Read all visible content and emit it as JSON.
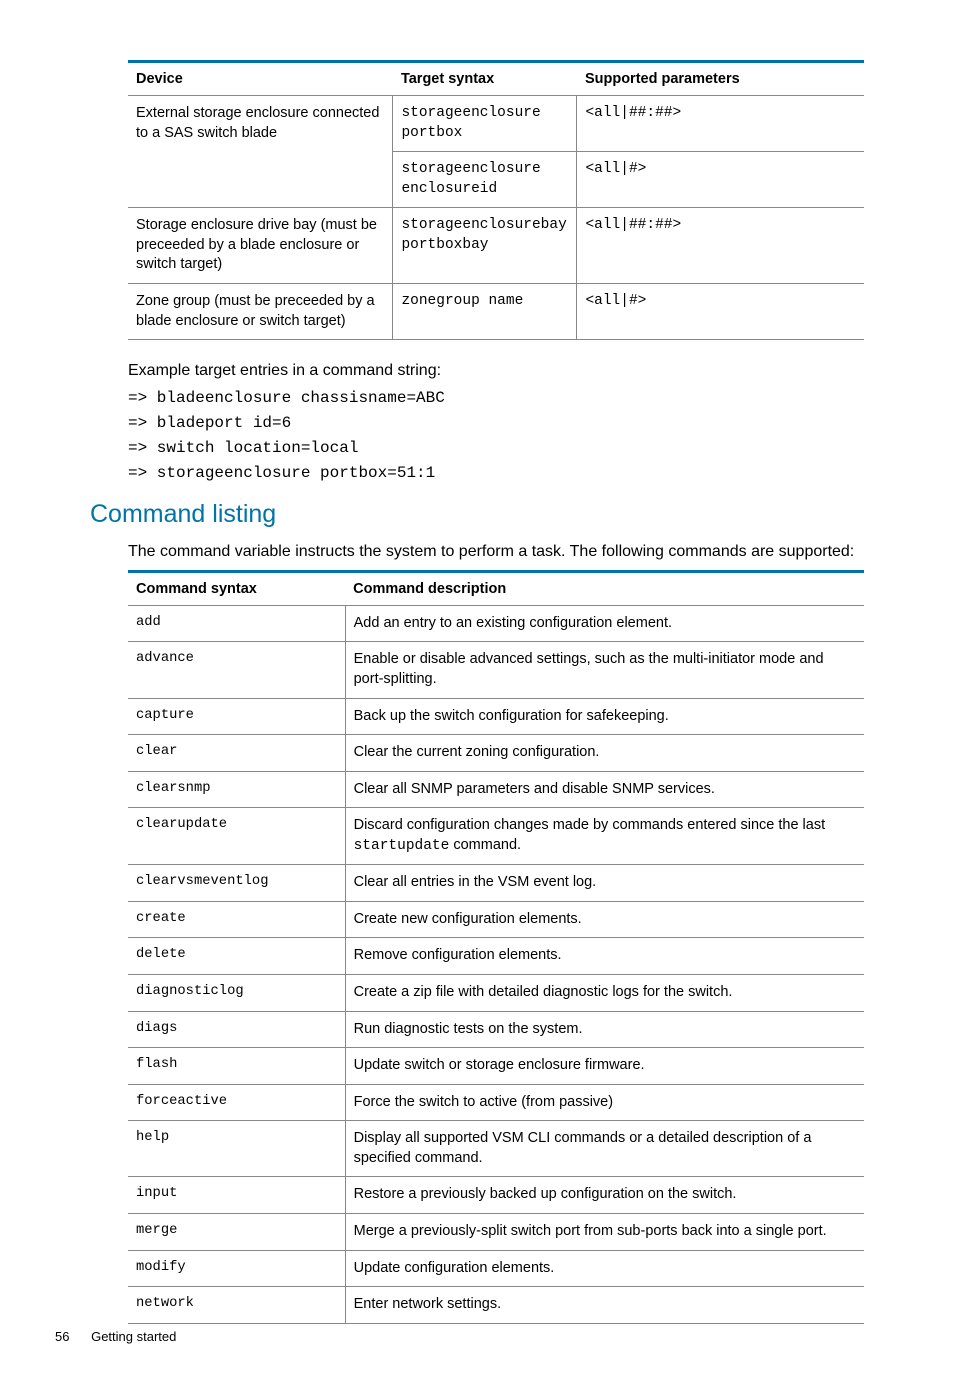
{
  "table1": {
    "headers": [
      "Device",
      "Target syntax",
      "Supported parameters"
    ],
    "rows": [
      {
        "c1": "External storage enclosure connected to a SAS switch blade",
        "c2": "storageenclosure portbox",
        "c3": "<all|##:##>",
        "cont": false
      },
      {
        "c1": "",
        "c2": "storageenclosure enclosureid",
        "c3": "<all|#>",
        "cont": true
      },
      {
        "c1": "Storage enclosure drive bay (must be preceeded by a blade enclosure or switch target)",
        "c2": "storageenclosurebay portboxbay",
        "c3": "<all|##:##>",
        "cont": false
      },
      {
        "c1": "Zone group (must be preceeded by a blade enclosure or switch target)",
        "c2": "zonegroup name",
        "c3": "<all|#>",
        "cont": false
      }
    ]
  },
  "example_intro": "Example target entries in a command string:",
  "examples": [
    "=> bladeenclosure chassisname=ABC",
    "=> bladeport id=6",
    "=> switch location=local",
    "=> storageenclosure portbox=51:1"
  ],
  "section_heading": "Command listing",
  "section_intro": "The command variable instructs the system to perform a task. The following commands are supported:",
  "table2": {
    "headers": [
      "Command syntax",
      "Command description"
    ],
    "rows": [
      {
        "cmd": "add",
        "desc_pre": "Add an entry to an existing configuration element.",
        "desc_mono": "",
        "desc_post": ""
      },
      {
        "cmd": "advance",
        "desc_pre": "Enable or disable advanced settings, such as the multi-initiator mode and port-splitting.",
        "desc_mono": "",
        "desc_post": ""
      },
      {
        "cmd": "capture",
        "desc_pre": "Back up the switch configuration for safekeeping.",
        "desc_mono": "",
        "desc_post": ""
      },
      {
        "cmd": "clear",
        "desc_pre": "Clear the current zoning configuration.",
        "desc_mono": "",
        "desc_post": ""
      },
      {
        "cmd": "clearsnmp",
        "desc_pre": "Clear all SNMP parameters and disable SNMP services.",
        "desc_mono": "",
        "desc_post": ""
      },
      {
        "cmd": "clearupdate",
        "desc_pre": "Discard configuration changes made by commands entered since the last ",
        "desc_mono": "startupdate",
        "desc_post": " command."
      },
      {
        "cmd": "clearvsmeventlog",
        "desc_pre": "Clear all entries in the VSM event log.",
        "desc_mono": "",
        "desc_post": ""
      },
      {
        "cmd": "create",
        "desc_pre": "Create new configuration elements.",
        "desc_mono": "",
        "desc_post": ""
      },
      {
        "cmd": "delete",
        "desc_pre": "Remove configuration elements.",
        "desc_mono": "",
        "desc_post": ""
      },
      {
        "cmd": "diagnosticlog",
        "desc_pre": "Create a zip file with detailed diagnostic logs for the switch.",
        "desc_mono": "",
        "desc_post": ""
      },
      {
        "cmd": "diags",
        "desc_pre": "Run diagnostic tests on the system.",
        "desc_mono": "",
        "desc_post": ""
      },
      {
        "cmd": "flash",
        "desc_pre": "Update switch or storage enclosure firmware.",
        "desc_mono": "",
        "desc_post": ""
      },
      {
        "cmd": "forceactive",
        "desc_pre": "Force the switch to active (from passive)",
        "desc_mono": "",
        "desc_post": ""
      },
      {
        "cmd": "help",
        "desc_pre": "Display all supported VSM CLI commands or a detailed description of a specified command.",
        "desc_mono": "",
        "desc_post": ""
      },
      {
        "cmd": "input",
        "desc_pre": "Restore a previously backed up configuration on the switch.",
        "desc_mono": "",
        "desc_post": ""
      },
      {
        "cmd": "merge",
        "desc_pre": "Merge a previously-split switch port from sub-ports back into a single port.",
        "desc_mono": "",
        "desc_post": ""
      },
      {
        "cmd": "modify",
        "desc_pre": "Update configuration elements.",
        "desc_mono": "",
        "desc_post": ""
      },
      {
        "cmd": "network",
        "desc_pre": "Enter network settings.",
        "desc_mono": "",
        "desc_post": ""
      }
    ]
  },
  "footer": {
    "page": "56",
    "title": "Getting started"
  }
}
